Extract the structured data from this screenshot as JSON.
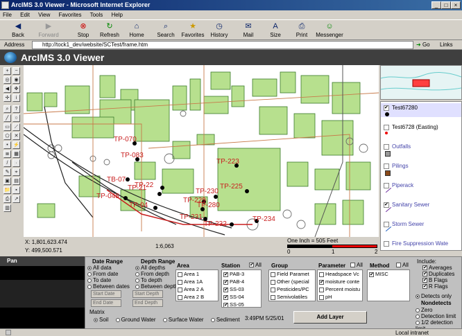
{
  "window": {
    "title": "ArcIMS 3.0 Viewer - Microsoft Internet Explorer"
  },
  "menu": [
    "File",
    "Edit",
    "View",
    "Favorites",
    "Tools",
    "Help"
  ],
  "toolbar": {
    "back": "Back",
    "forward": "Forward",
    "stop": "Stop",
    "refresh": "Refresh",
    "home": "Home",
    "search": "Search",
    "favorites": "Favorites",
    "history": "History",
    "mail": "Mail",
    "size": "Size",
    "print": "Print",
    "messenger": "Messenger"
  },
  "address": {
    "label": "Address",
    "value": "http://tock1_dev/website/SCTest/frame.htm",
    "go": "Go",
    "links": "Links"
  },
  "app": {
    "title": "ArcIMS 3.0 Viewer"
  },
  "map": {
    "labels": [
      "TP-070",
      "TP-083",
      "TB-07",
      "TP-22",
      "TP-048",
      "TP-04",
      "TP-230",
      "TP-229",
      "TP-231",
      "TP-232",
      "TP-234",
      "TP-223",
      "TP-225",
      "TP-280",
      "TP-21"
    ],
    "coord_x": "X: 1,801,623.474",
    "coord_y": "Y: 499,500.571",
    "scale": "1:6,063",
    "scalebar_label": "One Inch = 505 Feet",
    "scalebar_ticks": [
      "0",
      "1",
      "2"
    ]
  },
  "legend": {
    "items": [
      {
        "label": "Test67280",
        "checked": true,
        "symbol": "dot-black"
      },
      {
        "label": "Test6728 (Easting)",
        "checked": false,
        "symbol": "dot-red"
      },
      {
        "label": "Outfalls",
        "checked": false,
        "symbol": "square-gray"
      },
      {
        "label": "Pilings",
        "checked": false,
        "symbol": "square-brown"
      },
      {
        "label": "Piperack",
        "checked": false,
        "symbol": "line-purple"
      },
      {
        "label": "Sanitary Sewer",
        "checked": true,
        "symbol": "line-purple"
      },
      {
        "label": "Storm Sewer",
        "checked": false,
        "symbol": "line-blue"
      },
      {
        "label": "Fire Suppression Wate",
        "checked": false,
        "symbol": "line-red"
      }
    ]
  },
  "panel": {
    "pan_label": "Pan",
    "date_range": {
      "title": "Date Range",
      "options": [
        "All data",
        "From date",
        "To date",
        "Between dates"
      ],
      "selected": 0,
      "start_placeholder": "Start Date",
      "end_placeholder": "End Date"
    },
    "depth_range": {
      "title": "Depth Range",
      "options": [
        "All depths",
        "From depth",
        "To depth",
        "Between depths"
      ],
      "selected": 0,
      "start_placeholder": "Start Depth",
      "end_placeholder": "End Depth"
    },
    "matrix": {
      "title": "Matrix",
      "options": [
        "Soil",
        "Ground Water",
        "Surface Water",
        "Sediment"
      ],
      "selected": 0
    },
    "area": {
      "title": "Area",
      "items": [
        "Area 1",
        "Area 1A",
        "Area 2 A",
        "Area 2 B"
      ]
    },
    "station": {
      "title": "Station",
      "all_label": "All",
      "all_checked": true,
      "items": [
        "PAB-3",
        "PAB-4",
        "SS-03",
        "SS-04",
        "SS-05"
      ]
    },
    "group": {
      "title": "Group",
      "items": [
        "Field Paramet",
        "Other (special",
        "Pesticides/PC",
        "Semivolatiles"
      ]
    },
    "parameter": {
      "title": "Parameter",
      "all_label": "All",
      "items": [
        "Headspace Vc",
        "moisture conte",
        "Percent moistu",
        "pH"
      ]
    },
    "method": {
      "title": "Method",
      "all_label": "All",
      "items": [
        "MISC"
      ]
    },
    "include": {
      "title": "Include:",
      "items": [
        "Averages",
        "Duplicates",
        "B Flags",
        "R Flags"
      ]
    },
    "detects": {
      "options": [
        "Detects only"
      ],
      "selected": 0
    },
    "nondetects": {
      "title": "Nondetects",
      "options": [
        "Zero",
        "Detection limit",
        "1/2 detection limit"
      ]
    },
    "timestamp": "3:49PM 5/25/01",
    "add_layer": "Add Layer"
  },
  "status": {
    "zone": "Local intranet"
  },
  "colors": {
    "building": "#b7e08e",
    "building_edge": "#3a7a2a",
    "road": "#8a8a8a",
    "sewer": "#c81e1e",
    "titlebar": "#0a246a"
  }
}
